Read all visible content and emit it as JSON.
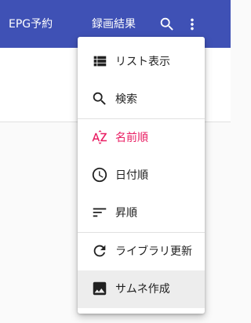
{
  "appbar": {
    "tabs": [
      {
        "label": "EPG予約"
      },
      {
        "label": "録画結果"
      }
    ],
    "search_icon": "search-icon",
    "more_icon": "more-vert-icon",
    "color": "#3f51b5"
  },
  "menu": {
    "items": [
      {
        "label": "リスト表示",
        "icon": "view-list-icon"
      },
      {
        "label": "検索",
        "icon": "search-icon"
      },
      {
        "label": "名前順",
        "icon": "sort-by-alpha-icon",
        "accent_color": "#e91e63"
      },
      {
        "label": "日付順",
        "icon": "clock-icon"
      },
      {
        "label": "昇順",
        "icon": "sort-icon"
      },
      {
        "label": "ライブラリ更新",
        "icon": "refresh-icon"
      },
      {
        "label": "サムネ作成",
        "icon": "image-icon"
      }
    ]
  }
}
